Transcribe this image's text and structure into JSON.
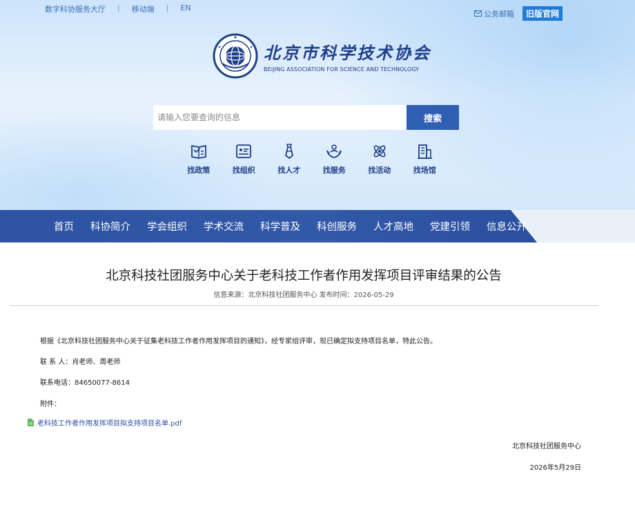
{
  "topbar": {
    "links": [
      "数字科协服务大厅",
      "移动端",
      "EN"
    ],
    "separator": "|",
    "mail_label": "公务邮箱",
    "old_site_label": "旧版官网"
  },
  "logo": {
    "name_cn": "北京市科学技术协会",
    "name_en": "BEIJING ASSOCIATION FOR SCIENCE AND TECHNOLOGY"
  },
  "search": {
    "placeholder": "请输入您要查询的信息",
    "button_label": "搜索"
  },
  "quick_links": [
    {
      "label": "找政策",
      "icon": "policy-icon"
    },
    {
      "label": "找组织",
      "icon": "organization-icon"
    },
    {
      "label": "找人才",
      "icon": "talent-icon"
    },
    {
      "label": "找服务",
      "icon": "service-icon"
    },
    {
      "label": "找活动",
      "icon": "activity-icon"
    },
    {
      "label": "找场馆",
      "icon": "venue-icon"
    }
  ],
  "nav": {
    "items": [
      "首页",
      "科协简介",
      "学会组织",
      "学术交流",
      "科学普及",
      "科创服务",
      "人才高地",
      "党建引领",
      "信息公开"
    ]
  },
  "article": {
    "title": "北京科技社团服务中心关于老科技工作者作用发挥项目评审结果的公告",
    "meta": "信息来源：北京科技社团服务中心   发布时间：2026-05-29",
    "body": [
      "根据《北京科技社团服务中心关于征集老科技工作者作用发挥项目的通知》，经专家组评审，现已确定拟支持项目名单，特此公告。",
      "联 系 人：肖老师、周老师",
      "联系电话：84650077-8614",
      "附件："
    ],
    "attachment": "老科技工作者作用发挥项目拟支持项目名单.pdf",
    "signature": "北京科技社团服务中心",
    "date": "2026年5月29日"
  },
  "colors": {
    "nav_blue": "#2d53a2",
    "accent_blue": "#1f7ad8",
    "search_blue": "#2f5fb2",
    "attachment_green": "#5cb85c"
  }
}
